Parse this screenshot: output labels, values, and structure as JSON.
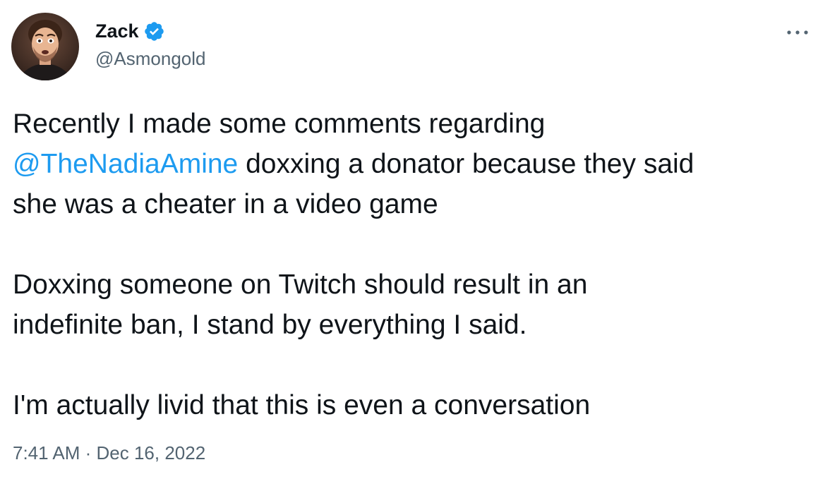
{
  "author": {
    "display_name": "Zack",
    "handle": "@Asmongold",
    "verified": true
  },
  "tweet": {
    "paragraphs": [
      {
        "lines": [
          [
            {
              "text": "Recently I made some comments regarding"
            }
          ],
          [
            {
              "text": "@TheNadiaAmine",
              "mention": true
            },
            {
              "text": " doxxing a donator because they said"
            }
          ],
          [
            {
              "text": "she was a cheater in a video game"
            }
          ]
        ]
      },
      {
        "lines": [
          [
            {
              "text": "Doxxing someone on Twitch should result in an"
            }
          ],
          [
            {
              "text": "indefinite ban, I stand by everything I said."
            }
          ]
        ]
      },
      {
        "lines": [
          [
            {
              "text": "I'm actually livid that this is even a conversation"
            }
          ]
        ]
      }
    ]
  },
  "meta": {
    "time": "7:41 AM",
    "separator": " · ",
    "date": "Dec 16, 2022"
  },
  "colors": {
    "text": "#0f1419",
    "secondary": "#536471",
    "accent": "#1d9bf0"
  },
  "icons": {
    "verified": "verified-badge-icon",
    "more": "more-options-icon"
  }
}
